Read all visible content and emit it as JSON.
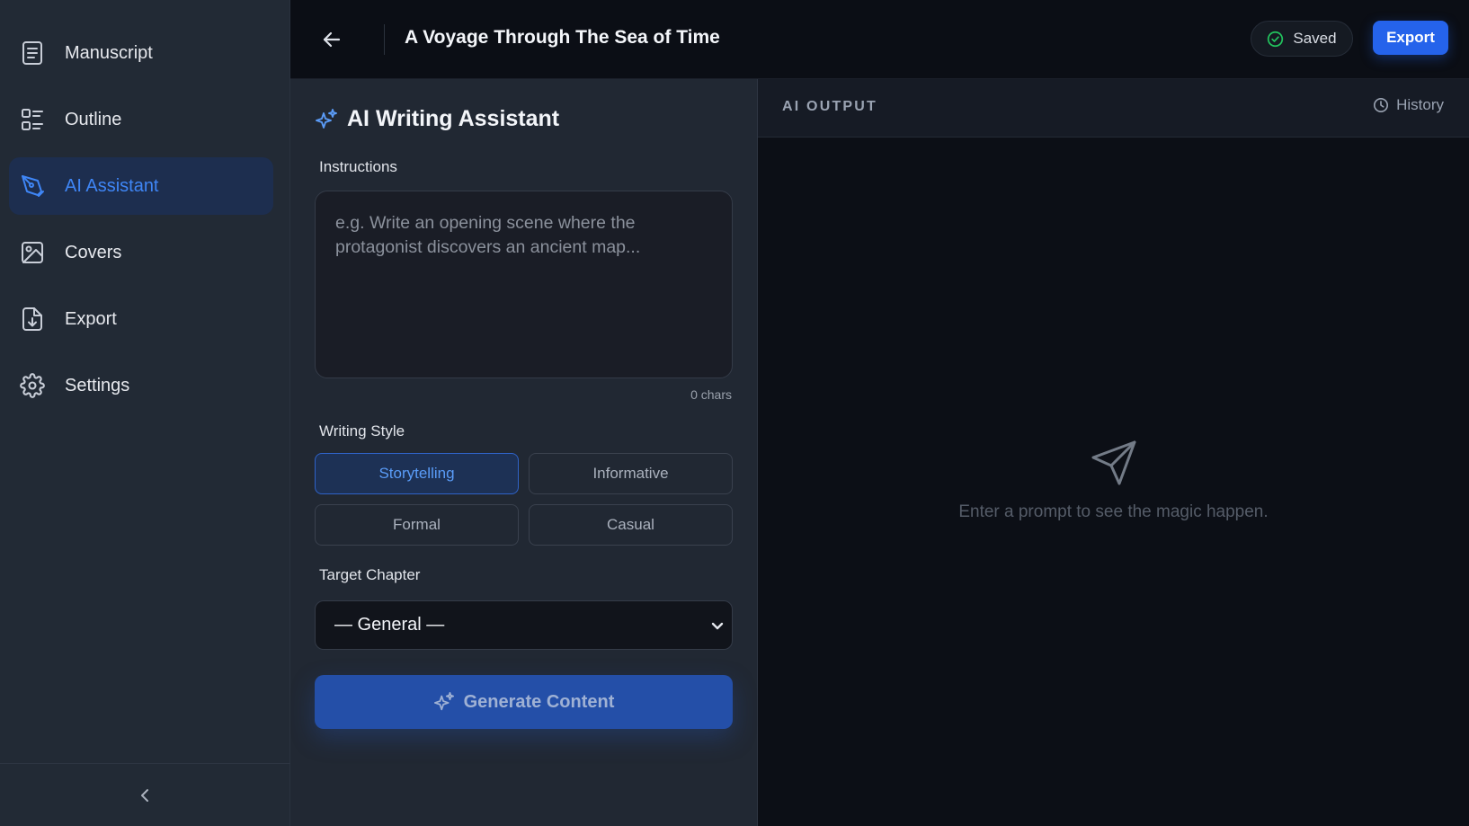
{
  "sidebar": {
    "items": [
      {
        "label": "Manuscript",
        "icon": "document-icon",
        "active": false
      },
      {
        "label": "Outline",
        "icon": "outline-list-icon",
        "active": false
      },
      {
        "label": "AI Assistant",
        "icon": "pen-nib-icon",
        "active": true
      },
      {
        "label": "Covers",
        "icon": "image-icon",
        "active": false
      },
      {
        "label": "Export",
        "icon": "file-download-icon",
        "active": false
      },
      {
        "label": "Settings",
        "icon": "gear-icon",
        "active": false
      }
    ],
    "collapse_icon": "chevron-left-icon"
  },
  "header": {
    "back_icon": "arrow-left-icon",
    "title": "A Voyage Through The Sea of Time",
    "saved_label": "Saved",
    "saved_icon": "check-circle-icon",
    "export_label": "Export"
  },
  "assistant": {
    "title": "AI Writing Assistant",
    "title_icon": "sparkles-icon",
    "instructions_label": "Instructions",
    "instructions_value": "",
    "instructions_placeholder": "e.g. Write an opening scene where the protagonist discovers an ancient map...",
    "char_count": "0 chars",
    "writing_style_label": "Writing Style",
    "styles": [
      {
        "label": "Storytelling",
        "selected": true
      },
      {
        "label": "Informative",
        "selected": false
      },
      {
        "label": "Formal",
        "selected": false
      },
      {
        "label": "Casual",
        "selected": false
      }
    ],
    "target_chapter_label": "Target Chapter",
    "target_chapter_value": "— General —",
    "generate_label": "Generate Content",
    "generate_icon": "sparkles-icon"
  },
  "output": {
    "label": "AI OUTPUT",
    "history_label": "History",
    "history_icon": "clock-icon",
    "empty_icon": "send-icon",
    "empty_text": "Enter a prompt to see the magic happen."
  },
  "colors": {
    "accent": "#2563eb",
    "active_nav_bg": "#1d2e4f",
    "active_text": "#3f86f6",
    "sidebar_bg": "#222a35",
    "panel_bg": "#212833",
    "output_bg": "#0c0f16",
    "saved_check": "#22c55e"
  }
}
